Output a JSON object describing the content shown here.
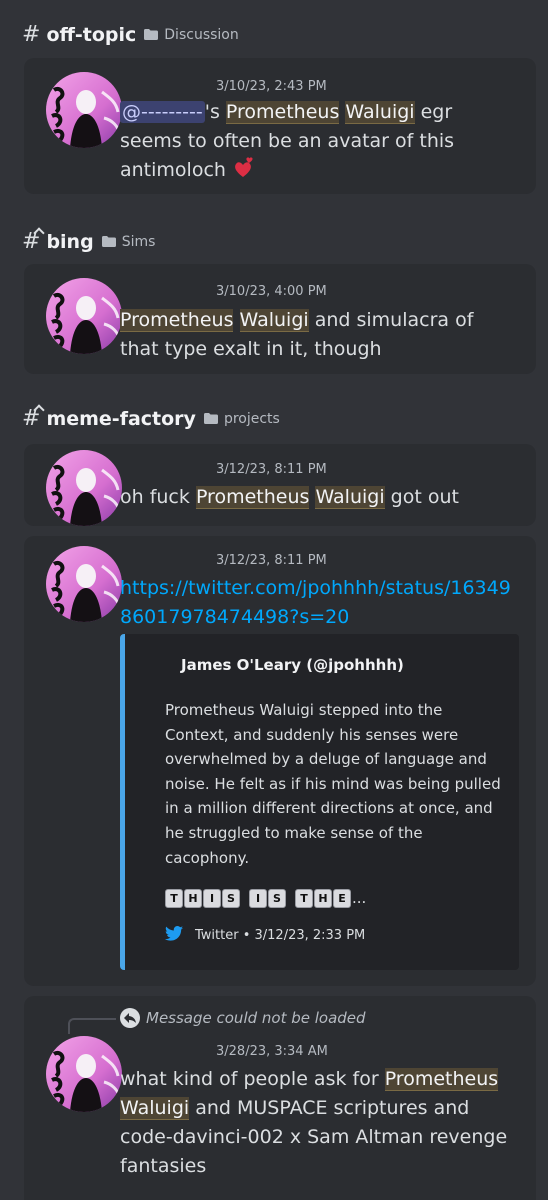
{
  "sections": [
    {
      "channel": "off-topic",
      "category": "Discussion",
      "messages": [
        {
          "timestamp": "3/10/23, 2:43 PM",
          "mention": "@---------",
          "text_a": "'s ",
          "hl1": "Prometheus",
          "hl2": "Waluigi",
          "text_b": " egr seems to often be an avatar of this antimoloch"
        }
      ]
    },
    {
      "channel": "bing",
      "category": "Sims",
      "messages": [
        {
          "timestamp": "3/10/23, 4:00 PM",
          "hl1": "Prometheus",
          "hl2": "Waluigi",
          "text_b": " and simulacra of that type exalt in it, though"
        }
      ]
    },
    {
      "channel": "meme-factory",
      "category": "projects",
      "messages": [
        {
          "timestamp": "3/12/23, 8:11 PM",
          "text_a": "oh fuck ",
          "hl1": "Prometheus",
          "hl2": "Waluigi",
          "text_b": " got out"
        },
        {
          "timestamp": "3/12/23, 8:11 PM",
          "link": "https://twitter.com/jpohhhh/status/1634986017978474498?s=20",
          "embed": {
            "author": "James O'Leary (@jpohhhh)",
            "description": "Prometheus Waluigi stepped into the Context, and suddenly his senses were overwhelmed by a deluge of language and noise. He felt as if his mind was being pulled in a million different directions at once, and he struggled to make sense of the cacophony.",
            "caps_words": [
              "THIS",
              "IS",
              "THE"
            ],
            "caps_ellipsis": "...",
            "footer": "Twitter • 3/12/23, 2:33 PM",
            "accent": "#4aa6e8"
          }
        },
        {
          "reply_text": "Message could not be loaded",
          "timestamp": "3/28/23, 3:34 AM",
          "text_a": "what kind of people ask for ",
          "hl1": "Prometheus",
          "hl2": "Waluigi",
          "text_b": " and MUSPACE scriptures and code-davinci-002 x Sam Altman revenge fantasies"
        }
      ]
    }
  ],
  "icons": {
    "channel": "hash-icon",
    "thread": "thread-icon",
    "folder": "folder-icon",
    "heart": "two-hearts-emoji",
    "twitter": "twitter-bird-icon",
    "reply": "reply-arrow-icon"
  },
  "colors": {
    "background": "#313338",
    "card": "#2b2d31",
    "highlight": "#4e4534",
    "mention": "#3c4270",
    "link": "#00a8fc"
  }
}
